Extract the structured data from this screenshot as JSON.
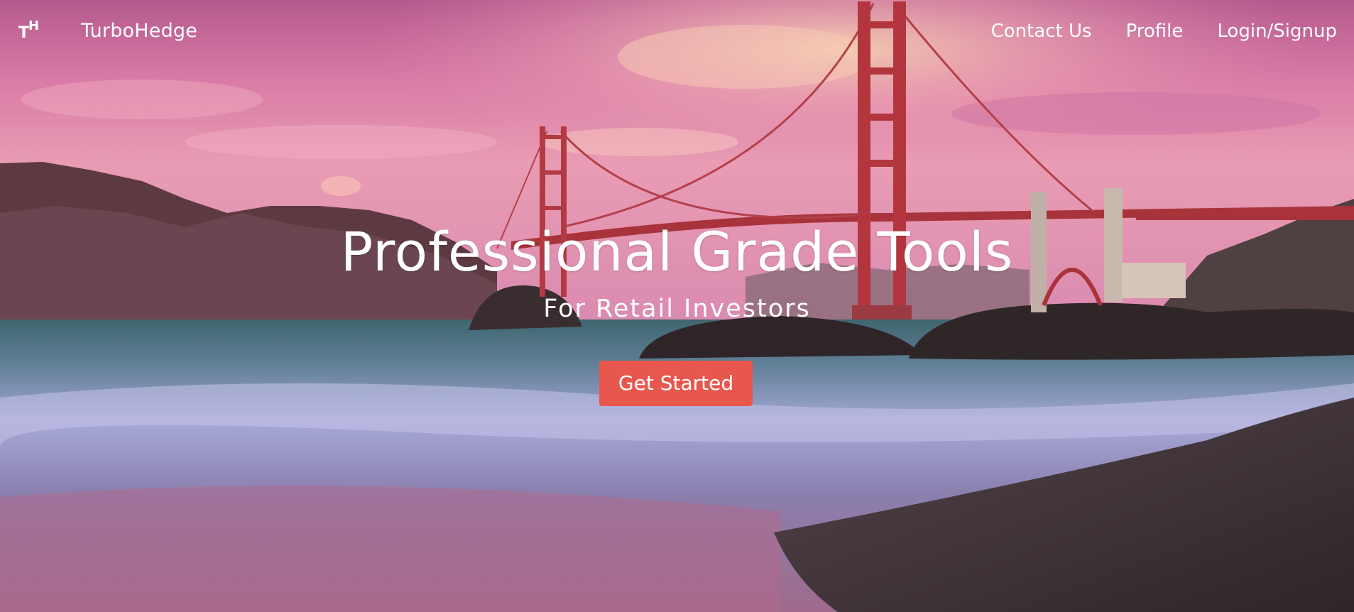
{
  "navbar": {
    "logo_text_t": "T",
    "logo_text_h": "H",
    "brand": "TurboHedge",
    "links": [
      {
        "label": "Contact Us"
      },
      {
        "label": "Profile"
      },
      {
        "label": "Login/Signup"
      }
    ]
  },
  "hero": {
    "headline": "Professional Grade Tools",
    "subheadline": "For Retail Investors",
    "cta_label": "Get Started",
    "background_image": "golden-gate-bridge-sunset-beach"
  },
  "colors": {
    "cta_background": "#e8574d",
    "nav_text": "#ffffff",
    "sky_top": "#c76a9a",
    "sky_mid": "#e89bb0",
    "water": "#8e93c4",
    "sand": "#3d3235",
    "bridge": "#b63a3a"
  }
}
